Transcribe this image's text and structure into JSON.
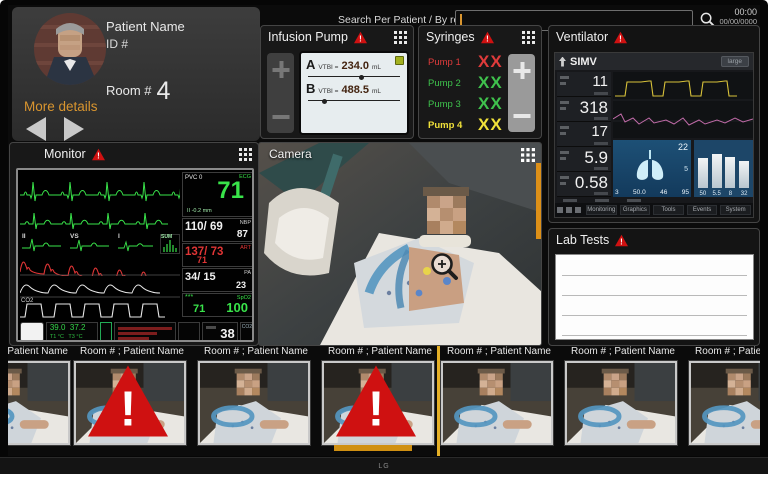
{
  "brand": "LG",
  "topbar": {
    "search_label": "Search Per Patient / By room",
    "search_value": "",
    "search_placeholder": "",
    "time": "00:00",
    "date": "00/00/0000"
  },
  "patient": {
    "name": "Patient Name",
    "id": "ID #",
    "room_label": "Room #",
    "room_value": "4",
    "more_details": "More details"
  },
  "infusion": {
    "title": "Infusion Pump",
    "lines": [
      {
        "id": "A",
        "param": "VTBI =",
        "value": "234.0",
        "unit": "mL"
      },
      {
        "id": "B",
        "param": "VTBI =",
        "value": "488.5",
        "unit": "mL"
      }
    ]
  },
  "syringes": {
    "title": "Syringes",
    "rows": [
      {
        "label": "Pump 1",
        "value": "XX",
        "color": "#e03b3b"
      },
      {
        "label": "Pump 2",
        "value": "XX",
        "color": "#3fc24d"
      },
      {
        "label": "Pump 3",
        "value": "XX",
        "color": "#3fc24d"
      },
      {
        "label": "Pump 4",
        "value": "XX",
        "color": "#f0e13a"
      }
    ]
  },
  "ventilator": {
    "title": "Ventilator",
    "mode": "SIMV",
    "size_button": "large",
    "params": [
      {
        "value": "11"
      },
      {
        "value": "318"
      },
      {
        "value": "17"
      },
      {
        "value": "5.9"
      },
      {
        "value": "0.58"
      }
    ],
    "lung": {
      "top": "22",
      "side": "5",
      "bottom": [
        "3",
        "50.0",
        "46",
        "95"
      ]
    },
    "bars": [
      {
        "value": "50"
      },
      {
        "value": "5.5"
      },
      {
        "value": "8"
      },
      {
        "value": "32"
      }
    ],
    "menu": [
      {
        "label": "Monitoring"
      },
      {
        "label": "Graphics"
      },
      {
        "label": "Tools"
      },
      {
        "label": "Events"
      },
      {
        "label": "System"
      }
    ]
  },
  "monitor": {
    "title": "Monitor",
    "ecg": {
      "pvc": "PVC 0",
      "hr": "71",
      "label": "ECG",
      "sub": "II -0.2 mm"
    },
    "nbp": {
      "value": "110/ 69",
      "mean": "87",
      "label": "NBP"
    },
    "art": {
      "value": "137/ 73",
      "mean": "71",
      "label": "ART"
    },
    "pa": {
      "value": "34/ 15",
      "mean": "23",
      "label": "PA"
    },
    "spo2": {
      "stars": "***",
      "pr": "71",
      "sat": "100",
      "label": "SpO2"
    },
    "leads": {
      "l1": "II",
      "l2": "VS",
      "l3": "I",
      "sum": "SUM"
    },
    "wave_co2_label": "CO2",
    "strip": {
      "t1": "39.0",
      "t2": "37.2",
      "t1_label": "T1 °C",
      "t2_label": "T3 °C",
      "resp": "38",
      "co2": "CO2"
    }
  },
  "camera": {
    "title": "Camera"
  },
  "lab": {
    "title": "Lab Tests"
  },
  "thumbs": {
    "labels": [
      "Room # ; Patient Name",
      "Room # ; Patient Name",
      "Room # ; Patient Name",
      "Room # ; Patient Name",
      "Room # ; Patient Name",
      "Room # ; Patient Name",
      "Room # ; Patient Name"
    ]
  },
  "colors": {
    "accent_orange": "#d9952f",
    "alert_red": "#cc1111",
    "ecg_green": "#2ee03c"
  }
}
